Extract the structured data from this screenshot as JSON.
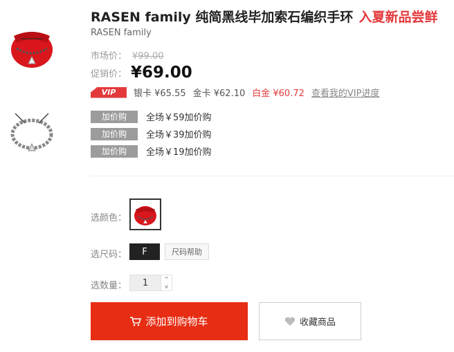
{
  "product": {
    "title": "RASEN family 纯简黑线毕加索石编织手环",
    "promo_text": "入夏新品尝鲜",
    "brand": "RASEN family"
  },
  "price": {
    "market_label": "市场价：",
    "market_value": "¥99.00",
    "promo_label": "促销价：",
    "promo_value": "¥69.00"
  },
  "vip": {
    "badge": "VIP",
    "silver": "银卡 ¥65.55",
    "gold_card": "金卡 ¥62.10",
    "platinum": "白金 ¥60.72",
    "link": "查看我的VIP进度"
  },
  "addons": [
    {
      "tag": "加价购",
      "text": "全场￥59加价购"
    },
    {
      "tag": "加价购",
      "text": "全场￥39加价购"
    },
    {
      "tag": "加价购",
      "text": "全场￥19加价购"
    }
  ],
  "options": {
    "color_label": "选颜色：",
    "size_label": "选尺码：",
    "size_value": "F",
    "size_help": "尺码帮助",
    "qty_label": "选数量：",
    "qty_value": "1",
    "qty_up": "^",
    "qty_down": "v"
  },
  "actions": {
    "cart": "添加到购物车",
    "favorite": "收藏商品"
  },
  "icons": {
    "cart": "cart-icon",
    "heart": "heart-icon"
  },
  "colors": {
    "accent": "#e4393c",
    "cart_button": "#e72d13",
    "tag_gray": "#9c9c9c"
  }
}
